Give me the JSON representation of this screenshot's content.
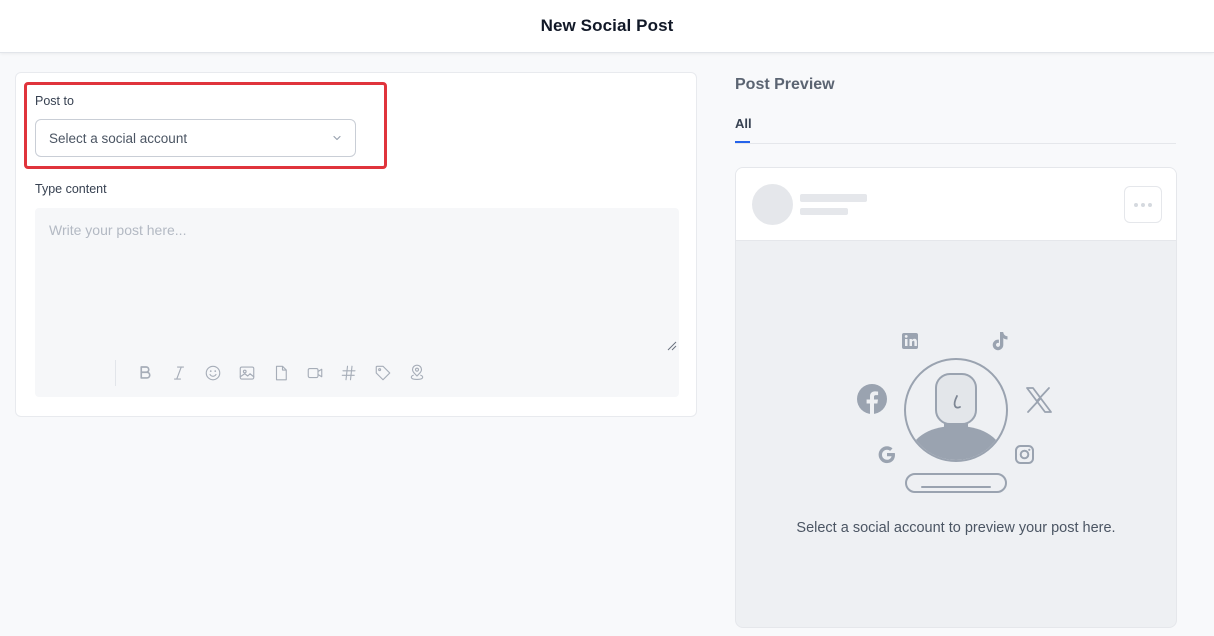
{
  "header": {
    "title": "New Social Post"
  },
  "editor": {
    "post_to_label": "Post to",
    "account_select_placeholder": "Select a social account",
    "type_content_label": "Type content",
    "content_placeholder": "Write your post here...",
    "toolbar": [
      "bold-icon",
      "italic-icon",
      "emoji-icon",
      "image-icon",
      "file-icon",
      "video-icon",
      "hashtag-icon",
      "tag-icon",
      "location-icon"
    ]
  },
  "preview": {
    "title": "Post Preview",
    "tabs": [
      {
        "label": "All",
        "active": true
      }
    ],
    "empty_message": "Select a social account to preview your post here.",
    "platform_icons": [
      "linkedin-icon",
      "tiktok-icon",
      "facebook-icon",
      "x-icon",
      "google-icon",
      "instagram-icon"
    ]
  },
  "colors": {
    "accent": "#2563eb",
    "highlight": "#e0343c",
    "icon_gray": "#9aa3b0"
  }
}
